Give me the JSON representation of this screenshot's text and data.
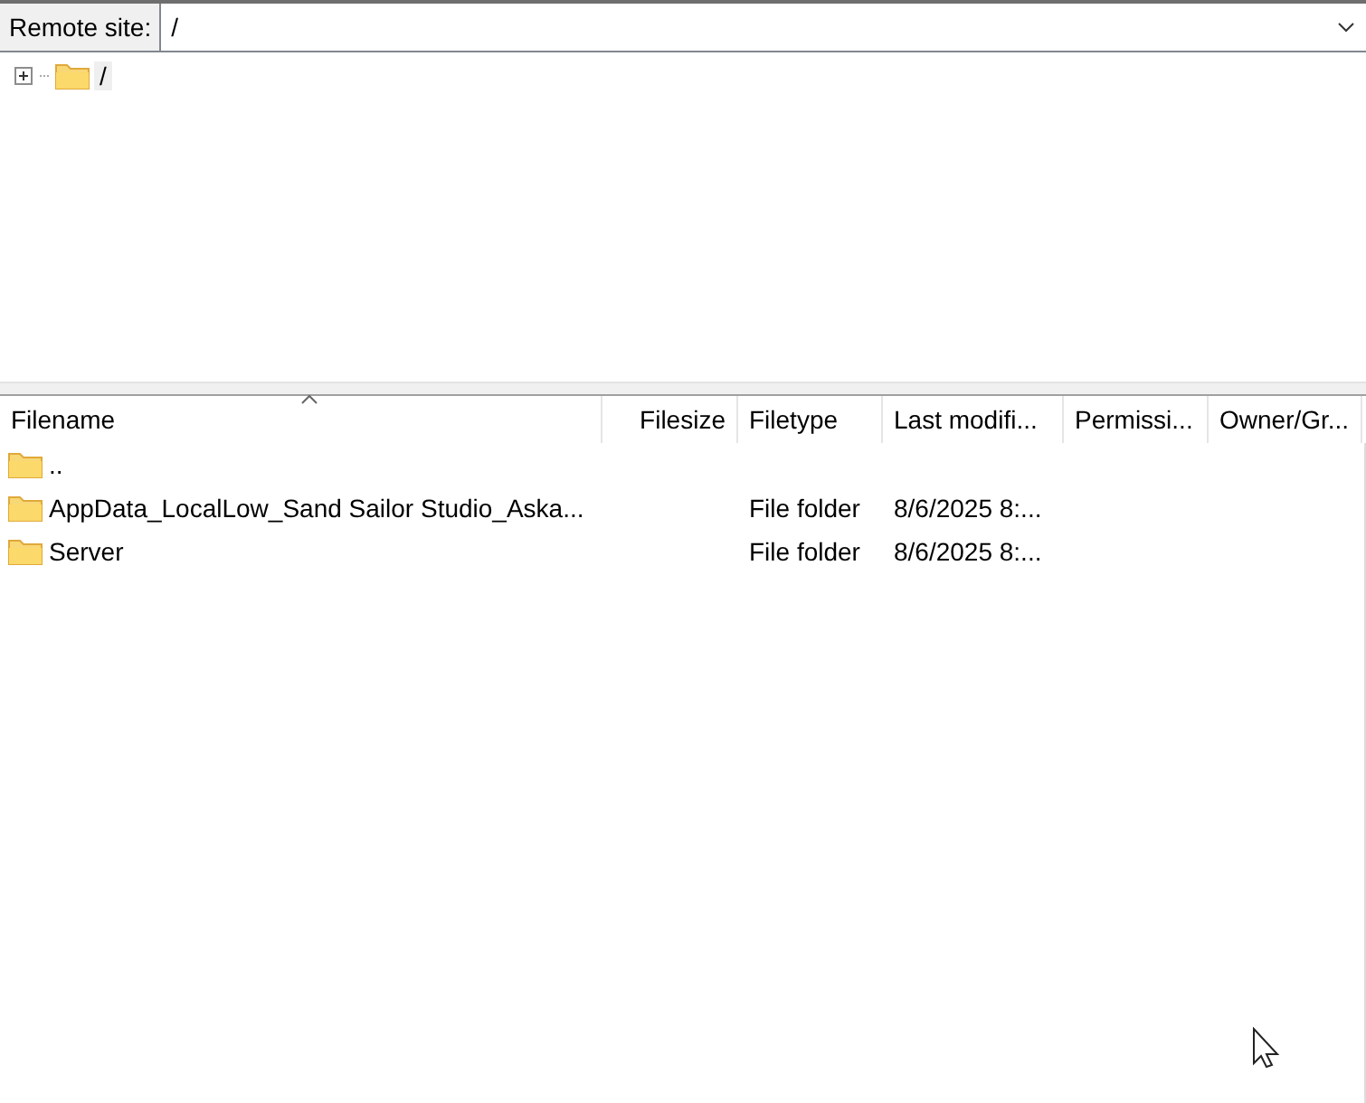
{
  "remote_site": {
    "label": "Remote site:",
    "value": "/"
  },
  "tree": {
    "items": [
      {
        "label": "/",
        "expanded": false,
        "selected": true
      }
    ]
  },
  "table": {
    "columns": [
      {
        "label": "Filename",
        "sorted": true
      },
      {
        "label": "Filesize",
        "sorted": false
      },
      {
        "label": "Filetype",
        "sorted": false
      },
      {
        "label": "Last modifi...",
        "sorted": false
      },
      {
        "label": "Permissi...",
        "sorted": false
      },
      {
        "label": "Owner/Gr...",
        "sorted": false
      }
    ],
    "rows": [
      {
        "filename": ".."
      },
      {
        "filename": "AppData_LocalLow_Sand Sailor Studio_Aska...",
        "filetype": "File folder",
        "last_modified": "8/6/2025 8:..."
      },
      {
        "filename": "Server",
        "filetype": "File folder",
        "last_modified": "8/6/2025 8:..."
      }
    ]
  }
}
